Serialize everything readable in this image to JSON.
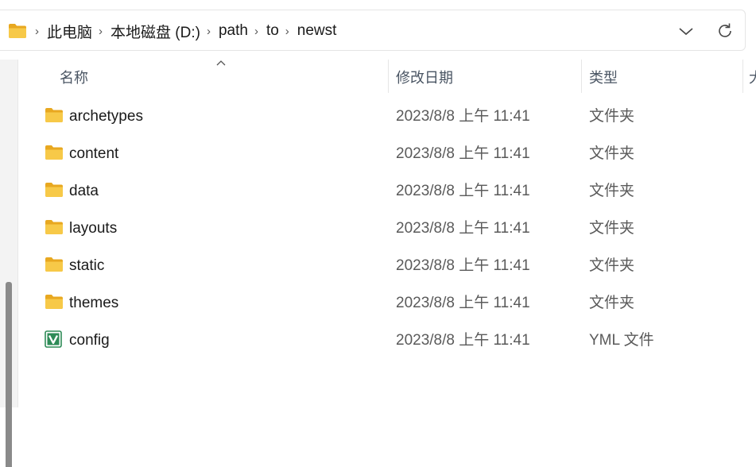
{
  "address_bar": {
    "crumbs": [
      "此电脑",
      "本地磁盘 (D:)",
      "path",
      "to",
      "newst"
    ]
  },
  "columns": {
    "name": "名称",
    "date": "修改日期",
    "type": "类型",
    "size_partial": "大"
  },
  "files": [
    {
      "name": "archetypes",
      "date": "2023/8/8 上午 11:41",
      "type": "文件夹",
      "icon": "folder-icon"
    },
    {
      "name": "content",
      "date": "2023/8/8 上午 11:41",
      "type": "文件夹",
      "icon": "folder-icon"
    },
    {
      "name": "data",
      "date": "2023/8/8 上午 11:41",
      "type": "文件夹",
      "icon": "folder-icon"
    },
    {
      "name": "layouts",
      "date": "2023/8/8 上午 11:41",
      "type": "文件夹",
      "icon": "folder-icon"
    },
    {
      "name": "static",
      "date": "2023/8/8 上午 11:41",
      "type": "文件夹",
      "icon": "folder-icon"
    },
    {
      "name": "themes",
      "date": "2023/8/8 上午 11:41",
      "type": "文件夹",
      "icon": "folder-icon"
    },
    {
      "name": "config",
      "date": "2023/8/8 上午 11:41",
      "type": "YML 文件",
      "icon": "yml-file-icon"
    }
  ],
  "colors": {
    "folder": "#f5c242",
    "folder_tab": "#e8a820",
    "yml_icon": "#2e8b57"
  }
}
